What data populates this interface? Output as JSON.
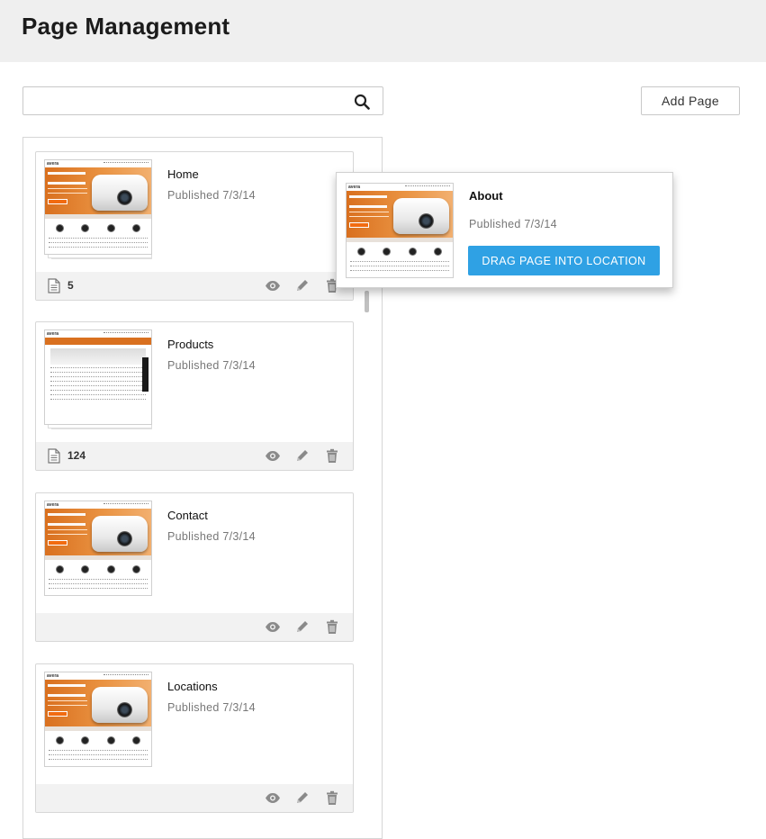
{
  "header": {
    "title": "Page Management"
  },
  "search": {
    "placeholder": "",
    "value": "",
    "icon": "search-icon"
  },
  "toolbar": {
    "add_page_label": "Add Page"
  },
  "pages": [
    {
      "name": "Home",
      "published": "Published 7/3/14",
      "count": "5",
      "thumbnail": "avera-home",
      "stacked": true
    },
    {
      "name": "Products",
      "published": "Published 7/3/14",
      "count": "124",
      "thumbnail": "avera-products",
      "stacked": true
    },
    {
      "name": "Contact",
      "published": "Published 7/3/14",
      "count": "",
      "thumbnail": "avera-home",
      "stacked": false
    },
    {
      "name": "Locations",
      "published": "Published 7/3/14",
      "count": "",
      "thumbnail": "avera-home",
      "stacked": false
    }
  ],
  "drag_popup": {
    "name": "About",
    "published": "Published 7/3/14",
    "button_label": "DRAG PAGE INTO LOCATION"
  },
  "thumbnail_text": {
    "logo": "avera"
  },
  "colors": {
    "accent": "#2fa1e4",
    "header_bg": "#efefef",
    "card_footer": "#f2f2f2",
    "icon_gray": "#8a8a8a"
  }
}
